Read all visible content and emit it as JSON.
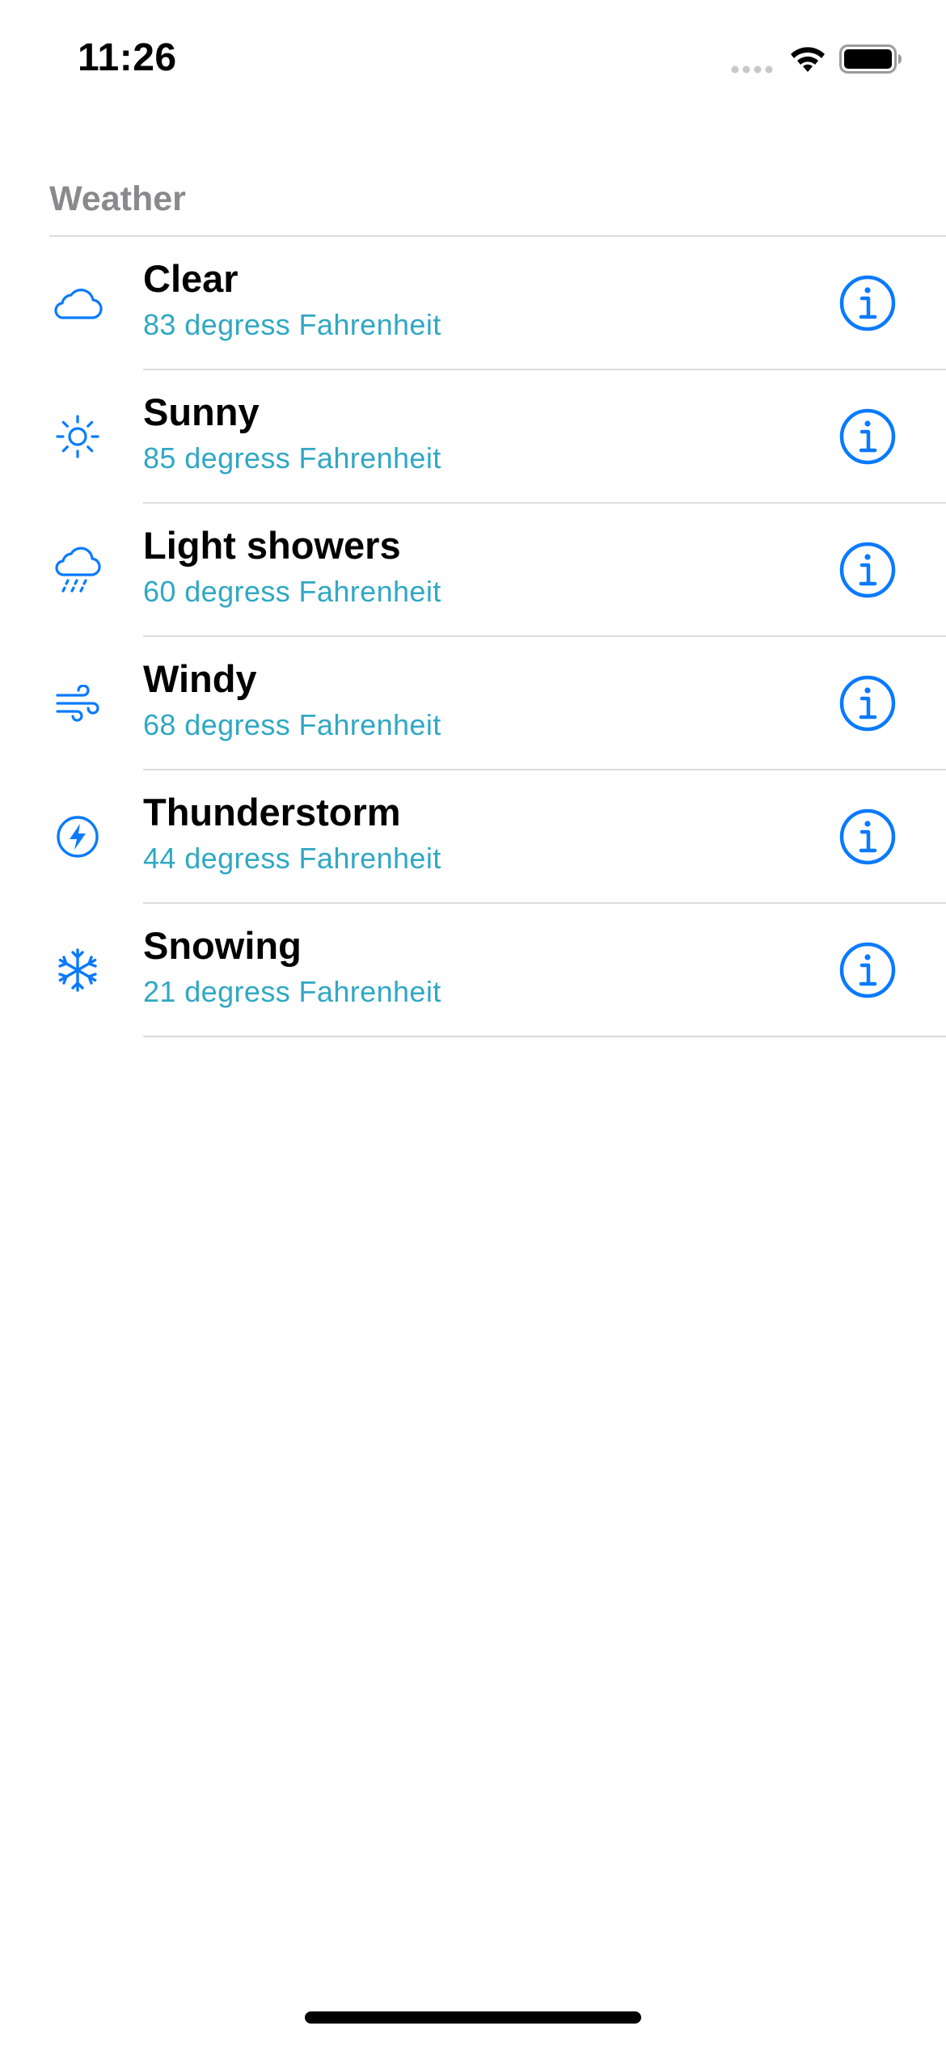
{
  "status_bar": {
    "time": "11:26"
  },
  "section": {
    "title": "Weather"
  },
  "colors": {
    "accent": "#0a7aff",
    "subtitle": "#30a8c4",
    "header": "#8a8a8e"
  },
  "rows": [
    {
      "title": "Clear",
      "subtitle": "83 degress Fahrenheit",
      "icon": "cloud-icon"
    },
    {
      "title": "Sunny",
      "subtitle": "85 degress Fahrenheit",
      "icon": "sun-icon"
    },
    {
      "title": "Light showers",
      "subtitle": "60 degress Fahrenheit",
      "icon": "cloud-drizzle-icon"
    },
    {
      "title": "Windy",
      "subtitle": "68 degress Fahrenheit",
      "icon": "wind-icon"
    },
    {
      "title": "Thunderstorm",
      "subtitle": "44 degress Fahrenheit",
      "icon": "bolt-circle-icon"
    },
    {
      "title": "Snowing",
      "subtitle": "21 degress Fahrenheit",
      "icon": "snowflake-icon"
    }
  ]
}
